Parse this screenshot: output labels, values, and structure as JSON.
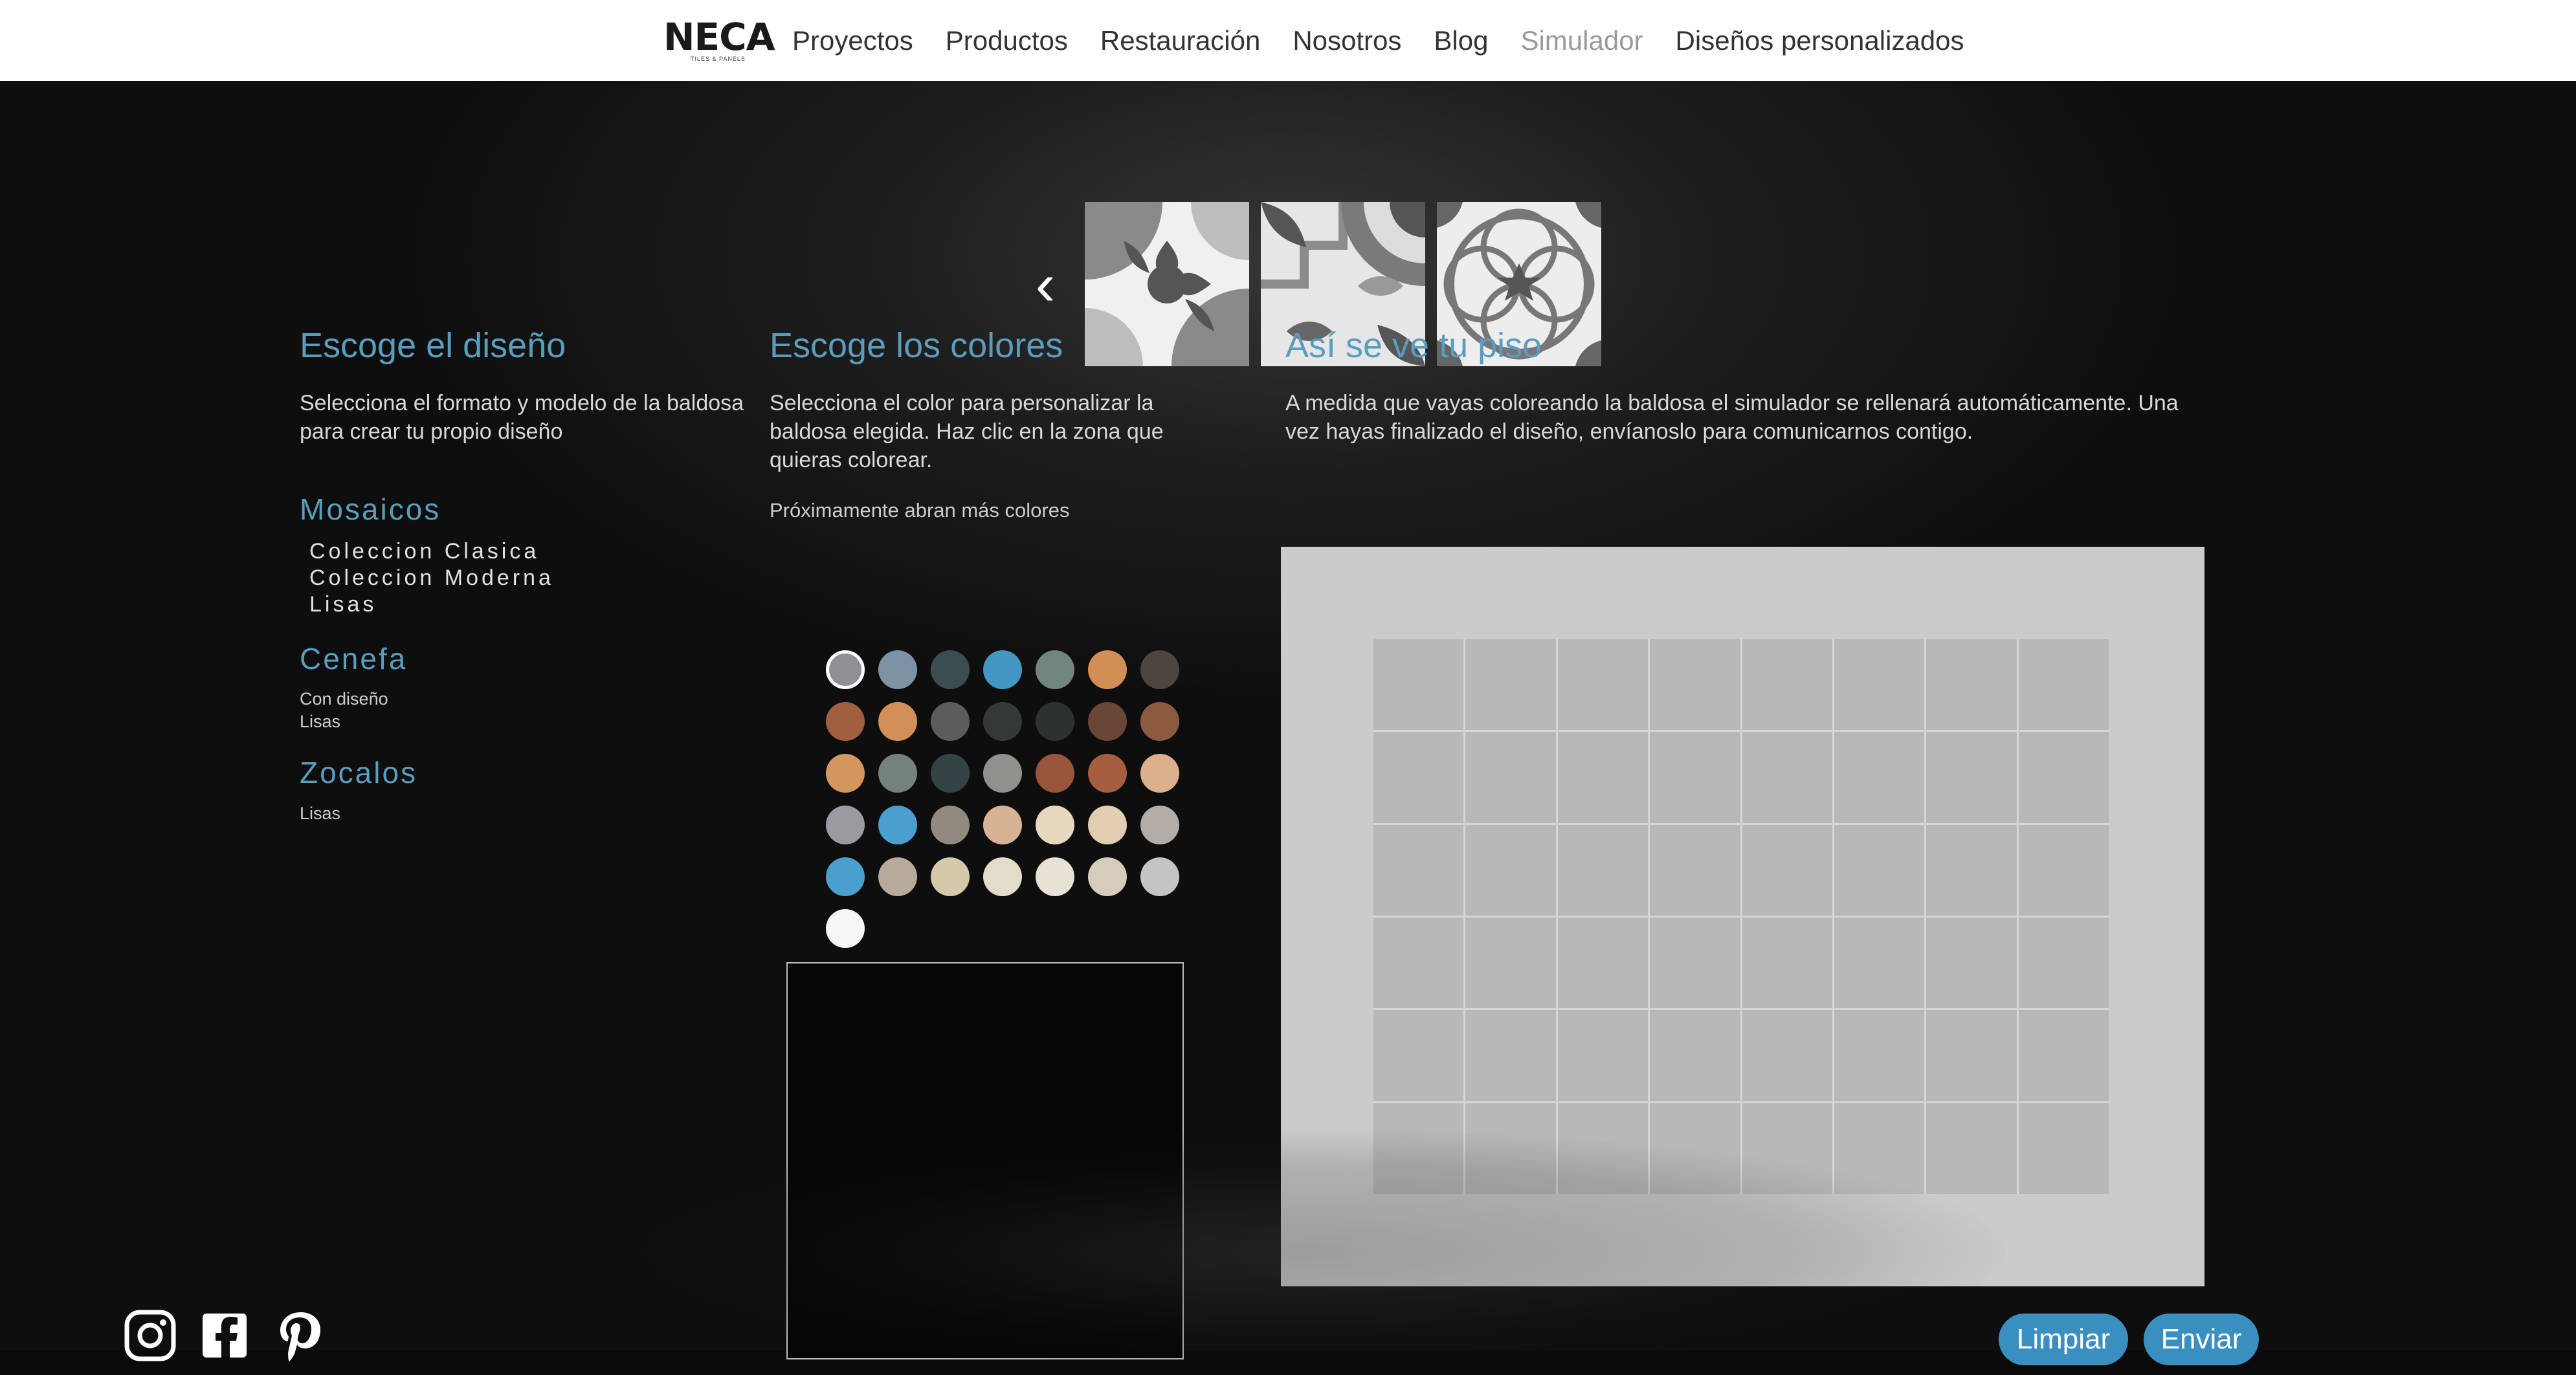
{
  "header": {
    "logo": {
      "text": "NECA",
      "subtitle": "TILES & PANELS"
    },
    "nav": [
      {
        "label": "Proyectos"
      },
      {
        "label": "Productos"
      },
      {
        "label": "Restauración"
      },
      {
        "label": "Nosotros"
      },
      {
        "label": "Blog"
      },
      {
        "label": "Simulador",
        "active": true
      },
      {
        "label": "Diseños personalizados"
      }
    ]
  },
  "carousel": {
    "prev_icon": "chevron-left-icon",
    "tiles": [
      "tile-design-1",
      "tile-design-2",
      "tile-design-3"
    ]
  },
  "design_section": {
    "title": "Escoge el diseño",
    "description": "Selecciona el formato y modelo de la baldosa para crear tu propio diseño",
    "categories": [
      {
        "title": "Mosaicos",
        "items": [
          "Coleccion Clasica",
          "Coleccion Moderna",
          "Lisas"
        ]
      },
      {
        "title": "Cenefa",
        "items": [
          "Con diseño",
          "Lisas"
        ]
      },
      {
        "title": "Zocalos",
        "items": [
          "Lisas"
        ]
      }
    ]
  },
  "colors_section": {
    "title": "Escoge los colores",
    "description": "Selecciona el color para personalizar la baldosa elegida. Haz clic en la zona que quieras colorear.",
    "note": "Próximamente abran más colores",
    "swatches": [
      "#8e9096",
      "#7b93a3",
      "#3c4d51",
      "#4597c3",
      "#738580",
      "#d28e55",
      "#4e4540",
      "#a0603d",
      "#d29058",
      "#5c5c5a",
      "#353839",
      "#2e3131",
      "#6a4636",
      "#8c5a3f",
      "#d6975f",
      "#75827b",
      "#344345",
      "#8e918c",
      "#99553c",
      "#a65e3e",
      "#dcb08c",
      "#9a9aa0",
      "#4a9fce",
      "#928a7c",
      "#d8b393",
      "#e8d8c0",
      "#e2ceb0",
      "#b4aca6",
      "#4a9fce",
      "#b8aa9a",
      "#d6c8aa",
      "#e4dcca",
      "#e8e2d6",
      "#d6ccbc",
      "#c4c4c6",
      "#f6f6f6"
    ],
    "selected_index": 0
  },
  "preview_section": {
    "title": "Así se ve tu piso",
    "description": "A medida que vayas coloreando la baldosa el simulador se rellenará automáticamente. Una vez hayas finalizado el diseño, envíanoslo para comunicarnos contigo.",
    "grid": {
      "columns": 8,
      "rows": 6
    },
    "tile_color": "#b8b8b8",
    "panel_color": "#cbcbcb"
  },
  "social": [
    {
      "icon": "instagram-icon"
    },
    {
      "icon": "facebook-icon"
    },
    {
      "icon": "pinterest-icon"
    }
  ],
  "actions": {
    "clear_label": "Limpiar",
    "send_label": "Enviar",
    "accent": "#3a8fc1"
  }
}
